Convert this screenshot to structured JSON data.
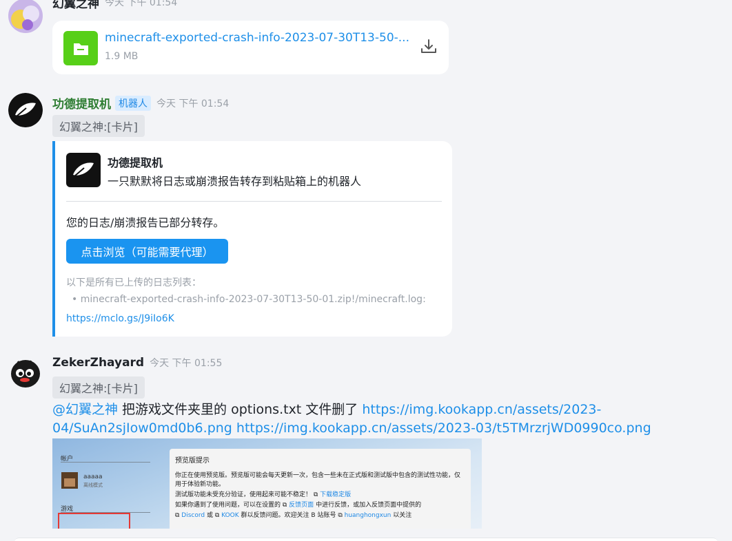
{
  "msg1": {
    "user": "幻翼之神",
    "time": "今天 下午 01:54",
    "file": {
      "name": "minecraft-exported-crash-info-2023-07-30T13-50-...",
      "size": "1.9 MB"
    }
  },
  "msg2": {
    "user": "功德提取机",
    "bot_tag": "机器人",
    "time": "今天 下午 01:54",
    "quote": "幻翼之神:[卡片]",
    "card": {
      "title": "功德提取机",
      "desc": "一只默默将日志或崩溃报告转存到粘贴箱上的机器人",
      "status": "您的日志/崩溃报告已部分转存。",
      "button": "点击浏览（可能需要代理）",
      "list_title": "以下是所有已上传的日志列表：",
      "list_item": "• minecraft-exported-crash-info-2023-07-30T13-50-01.zip!/minecraft.log:",
      "link": "https://mclo.gs/J9iIo6K"
    }
  },
  "msg3": {
    "user": "ZekerZhayard",
    "time": "今天 下午 01:55",
    "quote": "幻翼之神:[卡片]",
    "mention": "@幻翼之神",
    "text": " 把游戏文件夹里的 options.txt 文件删了 ",
    "link1": "https://img.kookapp.cn/assets/2023-04/SuAn2sjIow0md0b6.png",
    "link2": "https://img.kookapp.cn/assets/2023-03/t5TMrzrjWD0990co.png",
    "screenshot": {
      "side_title": "帐户",
      "account_name": "aaaaa",
      "account_mode": "离线模式",
      "game_label": "游戏",
      "panel_title": "预览版提示",
      "p1": "你正在使用预览版。预览版可能会每天更新一次，包含一些未在正式版和测试版中包含的测试性功能，仅用于体验新功能。",
      "p2": "测试版功能未受充分验证，使用起来可能不稳定！",
      "p2_link": "下载稳定版",
      "p3a": "如果你遇到了使用问题，可以在设置的",
      "p3_link": "反馈页面",
      "p3b": "中进行反馈，或加入反馈页面中提供的",
      "p4_link1": "Discord",
      "p4_or": "或",
      "p4_link2": "KOOK",
      "p4_mid": "群以反馈问题。欢迎关注 B 站账号",
      "p4_link3": "huanghongxun",
      "p4_end": "以关注"
    }
  }
}
